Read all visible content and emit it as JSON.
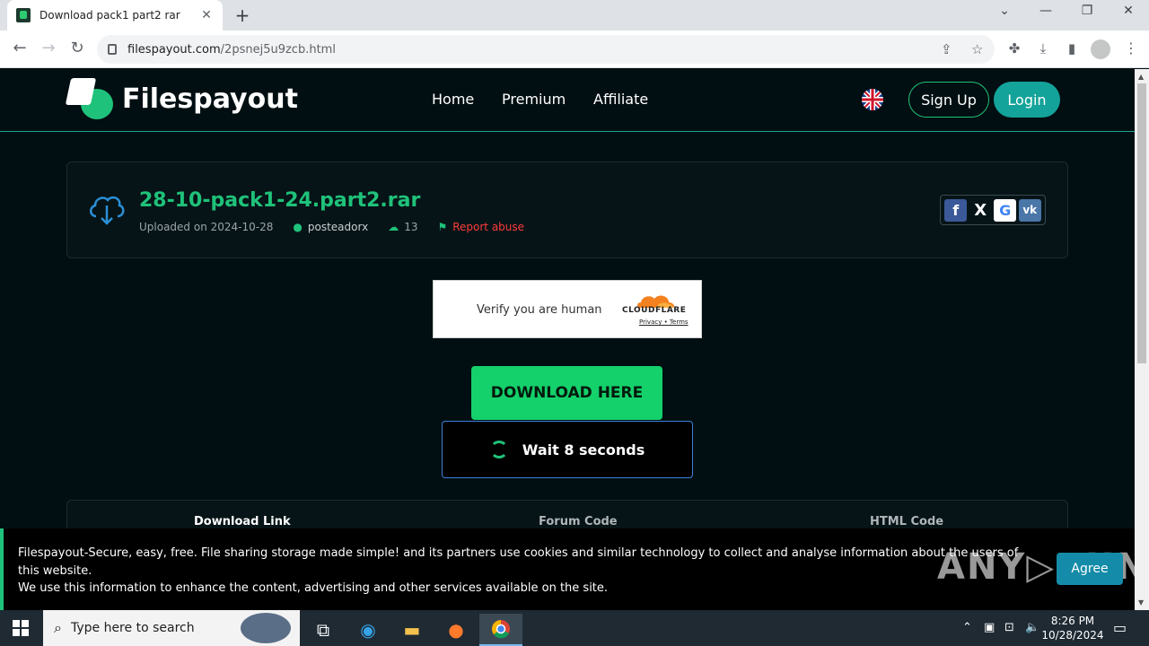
{
  "browser": {
    "tab_title": "Download pack1 part2 rar",
    "tab_close": "✕",
    "new_tab": "+",
    "url_domain": "filespayout.com",
    "url_path": "/2psnej5u9zcb.html",
    "window_controls": [
      "⌄",
      "—",
      "❐",
      "✕"
    ]
  },
  "site": {
    "brand": "Filespayout",
    "nav": [
      "Home",
      "Premium",
      "Affiliate"
    ],
    "signup": "Sign Up",
    "login": "Login"
  },
  "file": {
    "name": "28-10-pack1-24.part2.rar",
    "uploaded": "Uploaded on 2024-10-28",
    "user": "posteadorx",
    "downloads": "13",
    "report": "Report abuse",
    "share": [
      "f",
      "X",
      "G",
      "vk"
    ]
  },
  "captcha": {
    "label": "Verify you are human",
    "brand": "CLOUDFLARE",
    "links": "Privacy • Terms"
  },
  "download": {
    "button": "DOWNLOAD HERE",
    "wait": "Wait 8 seconds"
  },
  "panel_tabs": [
    "Download Link",
    "Forum Code",
    "HTML Code"
  ],
  "cookie": {
    "line1": "Filespayout-Secure, easy, free. File sharing storage made simple! and its partners use cookies and similar technology to collect and analyse information about the users of this website.",
    "line2": "We use this information to enhance the content, advertising and other services available on the site.",
    "agree": "Agree",
    "watermark": "ANY▷RUN"
  },
  "taskbar": {
    "search_placeholder": "Type here to search",
    "time": "8:26 PM",
    "date": "10/28/2024"
  }
}
